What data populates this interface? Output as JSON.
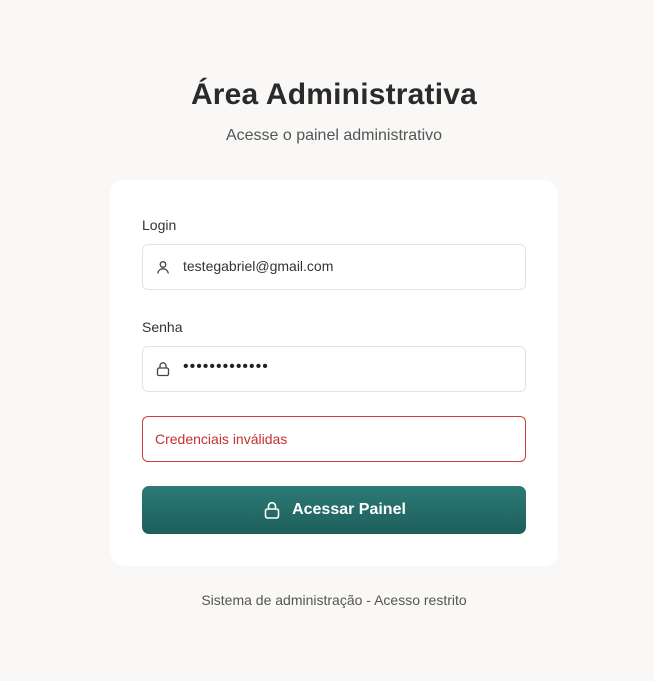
{
  "header": {
    "title": "Área Administrativa",
    "subtitle": "Acesse o painel administrativo"
  },
  "form": {
    "login": {
      "label": "Login",
      "value": "testegabriel@gmail.com",
      "icon": "user-icon"
    },
    "password": {
      "label": "Senha",
      "value": "•••••••••••••",
      "icon": "lock-icon"
    },
    "error_message": "Credenciais inválidas",
    "submit_label": "Acessar Painel",
    "submit_icon": "lock-icon"
  },
  "footer": {
    "text": "Sistema de administração - Acesso restrito"
  },
  "colors": {
    "background": "#f9f8f6",
    "card": "#ffffff",
    "accent": "#1f625e",
    "error": "#c53030"
  }
}
